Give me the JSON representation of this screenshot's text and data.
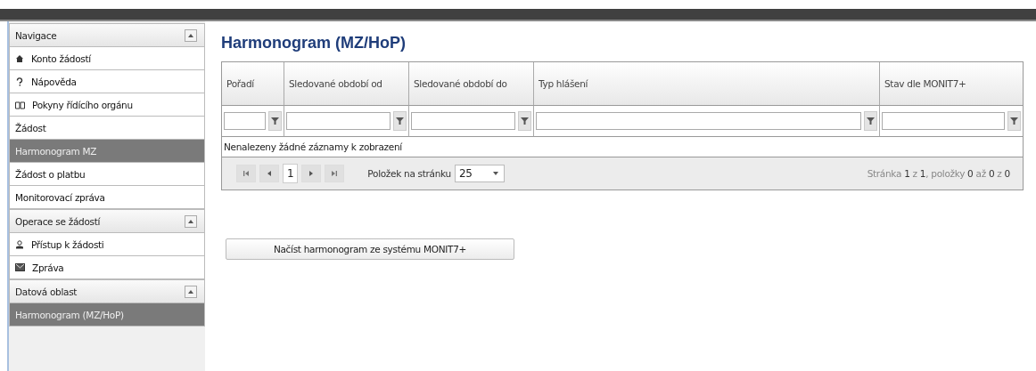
{
  "sidebar": {
    "sections": [
      {
        "title": "Navigace",
        "expanded": true,
        "items": [
          {
            "label": "Konto žádostí",
            "kind": "home",
            "selected": false
          },
          {
            "label": "Nápověda",
            "kind": "help",
            "selected": false
          },
          {
            "label": "Pokyny řídícího orgánu",
            "kind": "book",
            "selected": false
          },
          {
            "label": "Žádost",
            "kind": "plain",
            "selected": false
          },
          {
            "label": "Harmonogram MZ",
            "kind": "plain",
            "selected": true
          },
          {
            "label": "Žádost o platbu",
            "kind": "plain",
            "selected": false
          },
          {
            "label": "Monitorovací zpráva",
            "kind": "plain",
            "selected": false
          }
        ]
      },
      {
        "title": "Operace se žádostí",
        "expanded": true,
        "items": [
          {
            "label": "Přístup k žádosti",
            "kind": "user",
            "selected": false
          },
          {
            "label": "Zpráva",
            "kind": "mail",
            "selected": false
          }
        ]
      },
      {
        "title": "Datová oblast",
        "expanded": true,
        "items": [
          {
            "label": "Harmonogram (MZ/HoP)",
            "kind": "plain",
            "selected": true
          }
        ]
      }
    ]
  },
  "page_title": "Harmonogram (MZ/HoP)",
  "table": {
    "columns": [
      {
        "label": "Pořadí"
      },
      {
        "label": "Sledované období od"
      },
      {
        "label": "Sledované období do"
      },
      {
        "label": "Typ hlášení"
      },
      {
        "label": "Stav dle MONIT7+"
      }
    ],
    "empty_message": "Nenalezeny žádné záznamy k zobrazení",
    "pager": {
      "page": "1",
      "page_size_label": "Položek na stránku",
      "page_size": "25",
      "summary": "Stránka **1** z **1**, položky **0** až **0** z **0**"
    }
  },
  "load_button": "Načíst harmonogram ze systému MONIT7+"
}
